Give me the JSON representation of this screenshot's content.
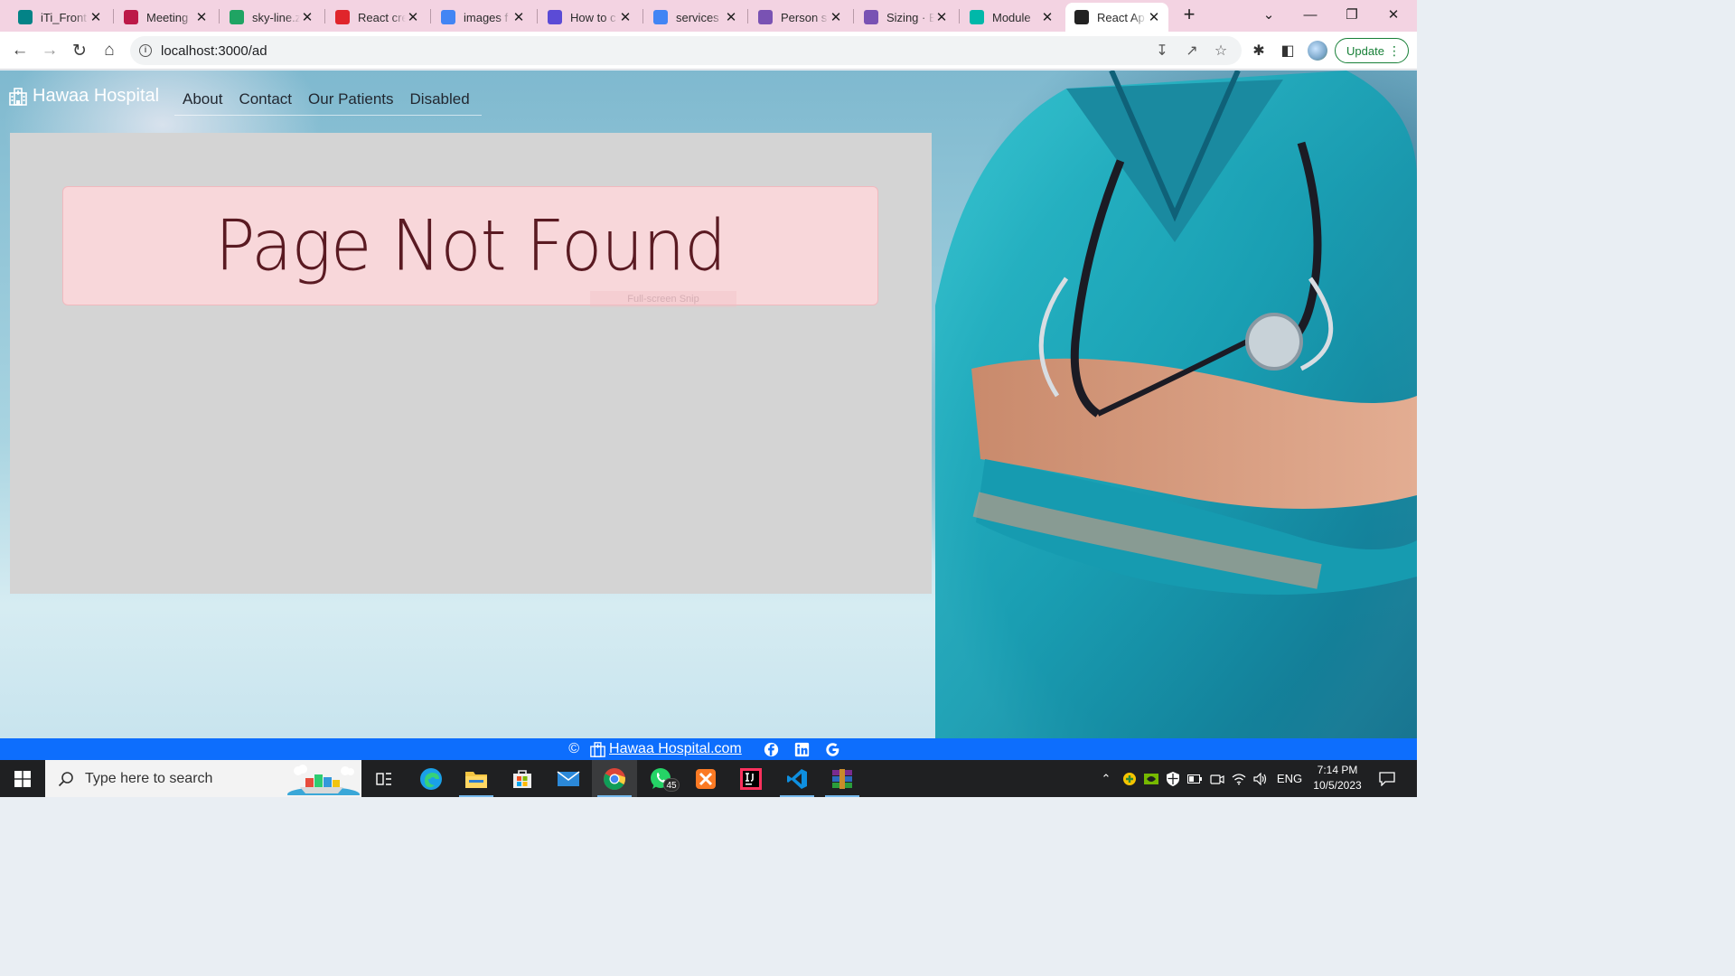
{
  "browser": {
    "tabs": [
      {
        "title": "iTi_Front",
        "icon": "sharepoint-icon",
        "color": "#038387"
      },
      {
        "title": "Meeting",
        "icon": "stream-icon",
        "color": "#bc1948"
      },
      {
        "title": "sky-line.z",
        "icon": "google-drive-icon",
        "color": "#1fa463"
      },
      {
        "title": "React cre",
        "icon": "vercel-icon",
        "color": "#e0252b"
      },
      {
        "title": "images f",
        "icon": "google-icon",
        "color": "#4285f4"
      },
      {
        "title": "How to c",
        "icon": "terminal-icon",
        "color": "#5b4bd6"
      },
      {
        "title": "services",
        "icon": "google-icon",
        "color": "#4285f4"
      },
      {
        "title": "Person s",
        "icon": "bootstrap-icon",
        "color": "#7952b3"
      },
      {
        "title": "Sizing · B",
        "icon": "bootstrap-icon",
        "color": "#7952b3"
      },
      {
        "title": "Module",
        "icon": "react-query-icon",
        "color": "#00b8a9"
      },
      {
        "title": "React Ap",
        "icon": "react-icon",
        "color": "#222222"
      }
    ],
    "url": "localhost:3000/ad",
    "update_label": "Update"
  },
  "site": {
    "brand": "Hawaa Hospital",
    "nav": [
      "About",
      "Contact",
      "Our Patients",
      "Disabled"
    ],
    "alert_text": "Page Not Found",
    "snip_text": "Full-screen Snip",
    "footer": {
      "copyright": "©",
      "link": "Hawaa Hospital.com",
      "social": [
        "facebook-icon",
        "linkedin-icon",
        "google-icon"
      ]
    }
  },
  "taskbar": {
    "search_placeholder": "Type here to search",
    "whatsapp_badge": "45",
    "language": "ENG",
    "time": "7:14 PM",
    "date": "10/5/2023"
  }
}
